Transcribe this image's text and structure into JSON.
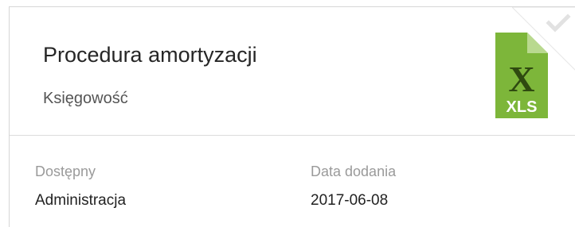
{
  "document": {
    "title": "Procedura amortyzacji",
    "category": "Księgowość",
    "file_type_label": "XLS",
    "file_letter": "X",
    "file_icon_name": "xls-file-icon",
    "accent_color": "#7db63a"
  },
  "details": {
    "available_label": "Dostępny",
    "available_value": "Administracja",
    "date_label": "Data dodania",
    "date_value": "2017-06-08"
  }
}
